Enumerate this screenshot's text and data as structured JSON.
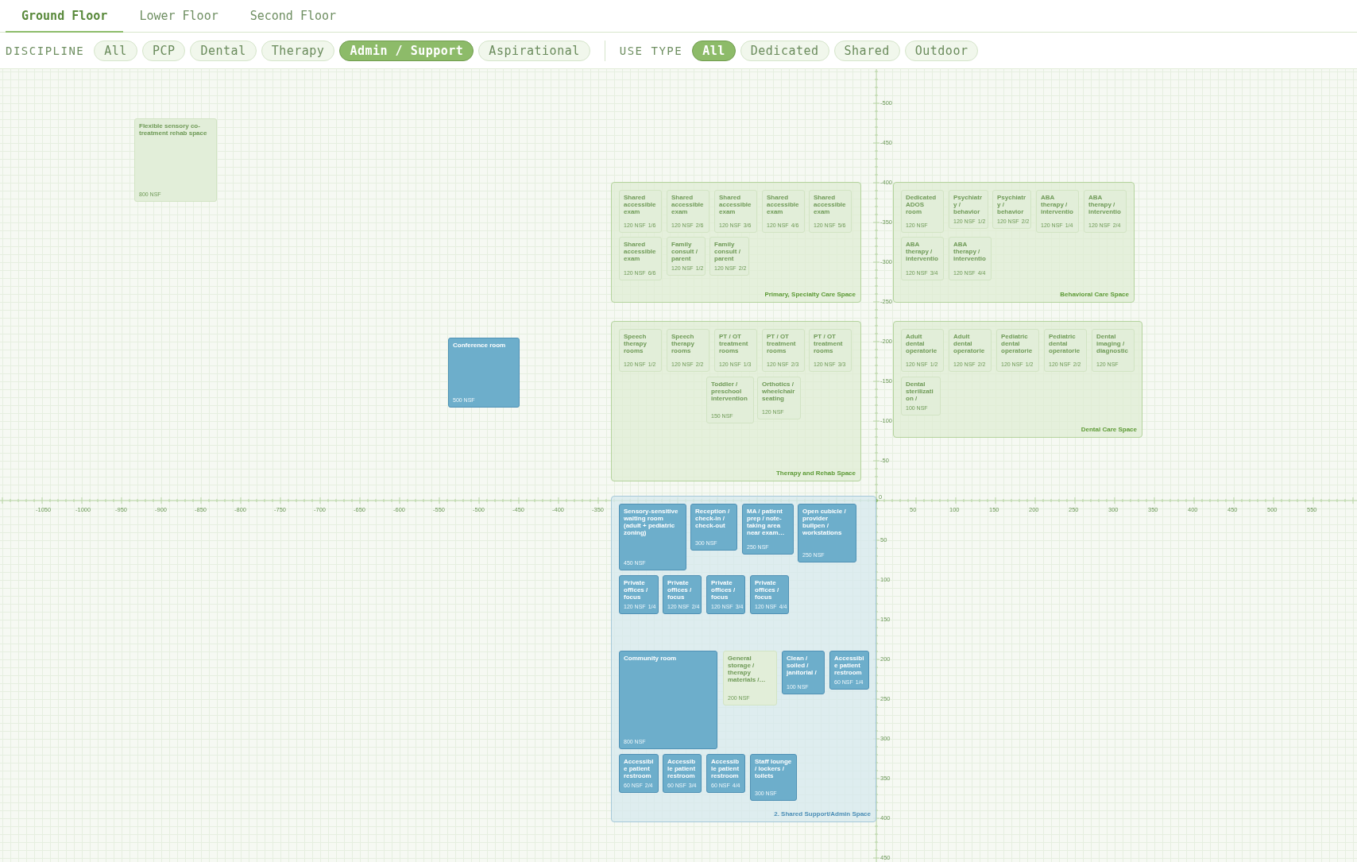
{
  "floor_tabs": [
    {
      "label": "Ground Floor",
      "selected": true
    },
    {
      "label": "Lower Floor",
      "selected": false
    },
    {
      "label": "Second Floor",
      "selected": false
    }
  ],
  "filters": [
    {
      "label": "DISCIPLINE",
      "options": [
        {
          "label": "All",
          "selected": false
        },
        {
          "label": "PCP",
          "selected": false
        },
        {
          "label": "Dental",
          "selected": false
        },
        {
          "label": "Therapy",
          "selected": false
        },
        {
          "label": "Admin / Support",
          "selected": true
        },
        {
          "label": "Aspirational",
          "selected": false
        }
      ]
    },
    {
      "label": "USE TYPE",
      "options": [
        {
          "label": "All",
          "selected": true
        },
        {
          "label": "Dedicated",
          "selected": false
        },
        {
          "label": "Shared",
          "selected": false
        },
        {
          "label": "Outdoor",
          "selected": false
        }
      ]
    }
  ],
  "canvas": {
    "origin_label": "0",
    "x_axis_labels": [
      "-1050",
      "-1000",
      "-950",
      "-900",
      "-850",
      "-800",
      "-750",
      "-700",
      "-650",
      "-600",
      "-550",
      "-500",
      "-450",
      "-400",
      "-350",
      "50",
      "100",
      "150",
      "200",
      "250",
      "300",
      "350",
      "400",
      "450",
      "500",
      "550"
    ],
    "y_axis_labels": [
      "-500",
      "-450",
      "-400",
      "-350",
      "-300",
      "-250",
      "-200",
      "-150",
      "-100",
      "-50",
      "50",
      "100",
      "150",
      "200",
      "250",
      "300",
      "350",
      "400",
      "450"
    ],
    "loose_rooms": [
      {
        "name": "Flexible sensory co-treatment rehab space",
        "area": "800 NSF",
        "dimmed": true
      },
      {
        "name": "Conference room",
        "area": "500 NSF",
        "dimmed": false
      }
    ],
    "zones": [
      {
        "name": "Primary, Specialty Care Space",
        "highlighted": false,
        "rooms": [
          {
            "name": "Shared accessible exam",
            "area": "120 NSF",
            "count": "1/6",
            "dimmed": true
          },
          {
            "name": "Shared accessible exam",
            "area": "120 NSF",
            "count": "2/6",
            "dimmed": true
          },
          {
            "name": "Shared accessible exam",
            "area": "120 NSF",
            "count": "3/6",
            "dimmed": true
          },
          {
            "name": "Shared accessible exam",
            "area": "120 NSF",
            "count": "4/6",
            "dimmed": true
          },
          {
            "name": "Shared accessible exam",
            "area": "120 NSF",
            "count": "5/6",
            "dimmed": true
          },
          {
            "name": "Shared accessible exam",
            "area": "120 NSF",
            "count": "6/6",
            "dimmed": true
          },
          {
            "name": "Family consult / parent",
            "area": "120 NSF",
            "count": "1/2",
            "dimmed": true
          },
          {
            "name": "Family consult / parent",
            "area": "120 NSF",
            "count": "2/2",
            "dimmed": true
          }
        ]
      },
      {
        "name": "Behavioral Care Space",
        "highlighted": false,
        "rooms": [
          {
            "name": "Dedicated ADOS room",
            "area": "120 NSF",
            "dimmed": true
          },
          {
            "name": "Psychiatry / behavior",
            "area": "120 NSF",
            "count": "1/2",
            "dimmed": true
          },
          {
            "name": "Psychiatry / behavior",
            "area": "120 NSF",
            "count": "2/2",
            "dimmed": true
          },
          {
            "name": "ABA therapy / interventio",
            "area": "120 NSF",
            "count": "1/4",
            "dimmed": true
          },
          {
            "name": "ABA therapy / interventio",
            "area": "120 NSF",
            "count": "2/4",
            "dimmed": true
          },
          {
            "name": "ABA therapy / interventio",
            "area": "120 NSF",
            "count": "3/4",
            "dimmed": true
          },
          {
            "name": "ABA therapy / interventio",
            "area": "120 NSF",
            "count": "4/4",
            "dimmed": true
          }
        ]
      },
      {
        "name": "Therapy and Rehab Space",
        "highlighted": false,
        "rooms": [
          {
            "name": "Speech therapy rooms",
            "area": "120 NSF",
            "count": "1/2",
            "dimmed": true
          },
          {
            "name": "Speech therapy rooms",
            "area": "120 NSF",
            "count": "2/2",
            "dimmed": true
          },
          {
            "name": "PT / OT treatment rooms",
            "area": "120 NSF",
            "count": "1/3",
            "dimmed": true
          },
          {
            "name": "PT / OT treatment rooms",
            "area": "120 NSF",
            "count": "2/3",
            "dimmed": true
          },
          {
            "name": "PT / OT treatment rooms",
            "area": "120 NSF",
            "count": "3/3",
            "dimmed": true
          },
          {
            "name": "Toddler / preschool intervention",
            "area": "150 NSF",
            "dimmed": true
          },
          {
            "name": "Orthotics / wheelchair seating",
            "area": "120 NSF",
            "dimmed": true
          }
        ]
      },
      {
        "name": "Dental Care Space",
        "highlighted": false,
        "rooms": [
          {
            "name": "Adult dental operatorie",
            "area": "120 NSF",
            "count": "1/2",
            "dimmed": true
          },
          {
            "name": "Adult dental operatorie",
            "area": "120 NSF",
            "count": "2/2",
            "dimmed": true
          },
          {
            "name": "Pediatric dental operatorie",
            "area": "120 NSF",
            "count": "1/2",
            "dimmed": true
          },
          {
            "name": "Pediatric dental operatorie",
            "area": "120 NSF",
            "count": "2/2",
            "dimmed": true
          },
          {
            "name": "Dental imaging / diagnostic",
            "area": "120 NSF",
            "dimmed": true
          },
          {
            "name": "Dental sterilization /",
            "area": "100 NSF",
            "dimmed": true
          }
        ]
      },
      {
        "name": "2. Shared Support/Admin Space",
        "highlighted": true,
        "rooms": [
          {
            "name": "Sensory-sensitive waiting room (adult + pediatric zoning)",
            "area": "450 NSF",
            "dimmed": false
          },
          {
            "name": "Reception / check-in / check-out",
            "area": "300 NSF",
            "dimmed": false
          },
          {
            "name": "MA / patient prep / note-taking area near exam…",
            "area": "250 NSF",
            "dimmed": false
          },
          {
            "name": "Open cubicle / provider bullpen / workstations",
            "area": "250 NSF",
            "dimmed": false
          },
          {
            "name": "Private offices / focus",
            "area": "120 NSF",
            "count": "1/4",
            "dimmed": false
          },
          {
            "name": "Private offices / focus",
            "area": "120 NSF",
            "count": "2/4",
            "dimmed": false
          },
          {
            "name": "Private offices / focus",
            "area": "120 NSF",
            "count": "3/4",
            "dimmed": false
          },
          {
            "name": "Private offices / focus",
            "area": "120 NSF",
            "count": "4/4",
            "dimmed": false
          },
          {
            "name": "Community room",
            "area": "800 NSF",
            "dimmed": false
          },
          {
            "name": "General storage / therapy materials /…",
            "area": "200 NSF",
            "dimmed": true
          },
          {
            "name": "Clean / soiled / janitorial /",
            "area": "100 NSF",
            "dimmed": false
          },
          {
            "name": "Accessible patient restroom",
            "area": "60 NSF",
            "count": "1/4",
            "dimmed": false
          },
          {
            "name": "Accessible patient restroom",
            "area": "60 NSF",
            "count": "2/4",
            "dimmed": false
          },
          {
            "name": "Accessible patient restroom",
            "area": "60 NSF",
            "count": "3/4",
            "dimmed": false
          },
          {
            "name": "Accessible patient restroom",
            "area": "60 NSF",
            "count": "4/4",
            "dimmed": false
          },
          {
            "name": "Staff lounge / lockers / toilets",
            "area": "300 NSF",
            "dimmed": false
          }
        ]
      }
    ]
  }
}
